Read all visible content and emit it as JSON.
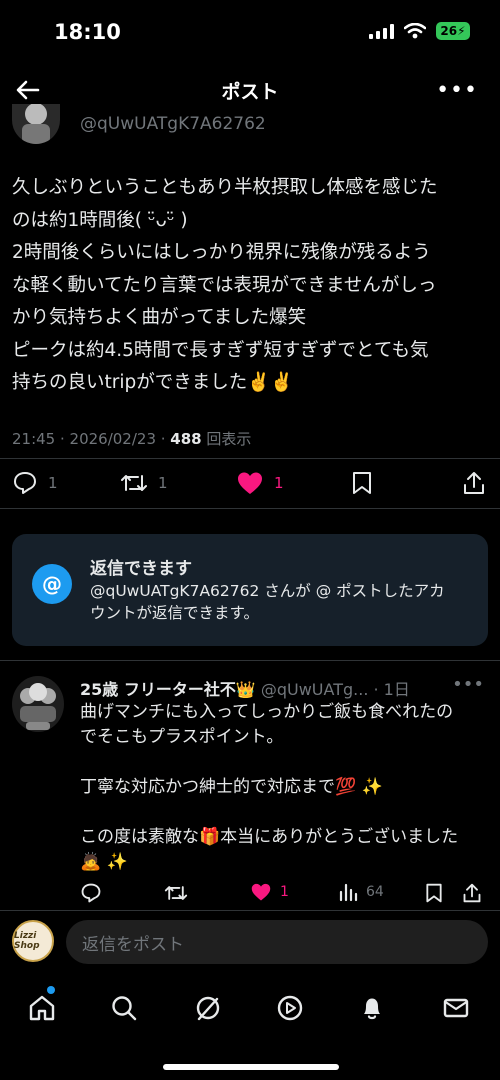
{
  "status_bar": {
    "time": "18:10",
    "battery": "26"
  },
  "nav": {
    "title": "ポスト"
  },
  "post": {
    "handle": "@qUwUATgK7A62762",
    "lines": [
      "久しぶりということもあり半枚摂取し体感を感じた",
      "のは約1時間後( ᵕ̈ᴗᵕ̈ )",
      "2時間後くらいにはしっかり視界に残像が残るよう",
      "な軽く動いてたり言葉では表現ができませんがしっ",
      "かり気持ちよく曲がってました爆笑",
      "ピークは約4.5時間で長すぎず短すぎずでとても気",
      "持ちの良いtripができました✌️✌️"
    ],
    "timestamp": "21:45 · 2026/02/23 · ",
    "views_count": "488",
    "views_label": " 回表示",
    "replies": "1",
    "reposts": "1",
    "likes": "1"
  },
  "reply_notice": {
    "title": "返信できます",
    "desc_line1": "@qUwUATgK7A62762 さんが @ ポストしたアカ",
    "desc_line2": "ウントが返信できます。"
  },
  "reply": {
    "name": "25歳 フリーター社不👑",
    "handle": " @qUwUATg...",
    "time": " · 1日",
    "lines": [
      "曲げマンチにも入ってしっかりご飯も食べれたの",
      "でそこもプラスポイント。",
      "",
      "丁寧な対応かつ紳士的で対応まで💯 ✨",
      "",
      "この度は素敵な🎁本当にありがとうございました",
      "🙇 ✨"
    ],
    "likes": "1",
    "views": "64"
  },
  "compose": {
    "placeholder": "返信をポスト",
    "avatar_text": "Lizzi Shop"
  },
  "colors": {
    "accent": "#1d9bf0",
    "like": "#f91880",
    "muted": "#71767b"
  }
}
